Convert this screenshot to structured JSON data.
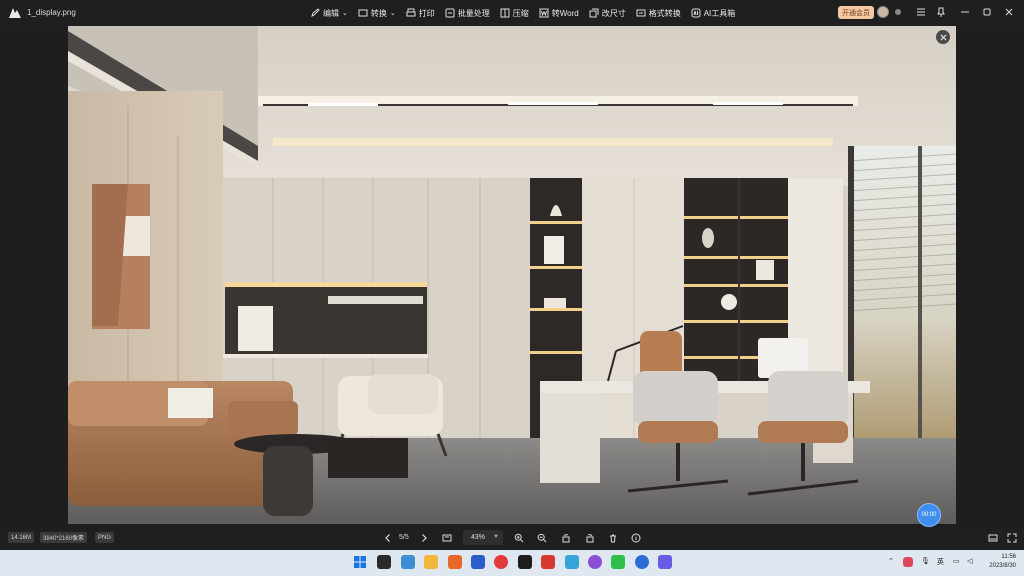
{
  "window": {
    "filename": "1_display.png"
  },
  "toolbar": {
    "items": [
      {
        "label": "编辑",
        "icon": "edit-icon",
        "caret": "⌄"
      },
      {
        "label": "转换",
        "icon": "convert-icon",
        "caret": "⌄"
      },
      {
        "label": "打印",
        "icon": "print-icon",
        "caret": ""
      },
      {
        "label": "批量处理",
        "icon": "batch-icon",
        "caret": ""
      },
      {
        "label": "压缩",
        "icon": "compress-icon",
        "caret": ""
      },
      {
        "label": "转Word",
        "icon": "word-icon",
        "caret": ""
      },
      {
        "label": "改尺寸",
        "icon": "resize-icon",
        "caret": ""
      },
      {
        "label": "格式转换",
        "icon": "format-icon",
        "caret": ""
      },
      {
        "label": "AI工具箱",
        "icon": "ai-icon",
        "caret": ""
      }
    ],
    "vip_label": "开通会员"
  },
  "viewer": {
    "timer_label": "00:00"
  },
  "status": {
    "file_size": "14.16M",
    "dimensions": "3840*2160像素",
    "format": "PNG",
    "page": "5/5",
    "zoom": "43%"
  },
  "taskbar": {
    "time": "11:56",
    "date": "2023/8/30",
    "ime": "英"
  },
  "colors": {
    "accent": "#3d8ef0",
    "vip_bg": "#f3c9a4",
    "taskbar_bg": "#dfe7f1"
  }
}
